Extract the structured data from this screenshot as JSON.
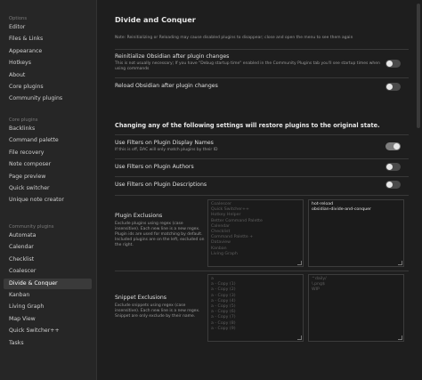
{
  "sidebar": {
    "sections": [
      {
        "label": "Options",
        "items": [
          "Editor",
          "Files & Links",
          "Appearance",
          "Hotkeys",
          "About",
          "Core plugins",
          "Community plugins"
        ]
      },
      {
        "label": "Core plugins",
        "items": [
          "Backlinks",
          "Command palette",
          "File recovery",
          "Note composer",
          "Page preview",
          "Quick switcher",
          "Unique note creator"
        ]
      },
      {
        "label": "Community plugins",
        "items": [
          "Automata",
          "Calendar",
          "Checklist",
          "Coalescer",
          "Divide & Conquer",
          "Kanban",
          "Living Graph",
          "Map View",
          "Quick Switcher++",
          "Tasks"
        ]
      }
    ],
    "active": "Divide & Conquer"
  },
  "main": {
    "title": "Divide and Conquer",
    "note": "Note: Reinitializing or Reloading may cause disabled plugins to disappear; close and open the menu to see them again",
    "settings": [
      {
        "name": "Reinitialize Obsidian after plugin changes",
        "desc": "This is not usually necessary; If you have \"Debug startup time\" enabled in the Community Plugins tab you'll see startup times when using commands",
        "on": false
      },
      {
        "name": "Reload Obsidian after plugin changes",
        "desc": "",
        "on": false
      }
    ],
    "section_heading": "Changing any of the following settings will restore plugins to the original state.",
    "filter_settings": [
      {
        "name": "Use Filters on Plugin Display Names",
        "desc": "If this is off, DAC will only match plugins by their ID",
        "on": true
      },
      {
        "name": "Use Filters on Plugin Authors",
        "desc": "",
        "on": false
      },
      {
        "name": "Use Filters on Plugin Descriptions",
        "desc": "",
        "on": false
      }
    ],
    "plugin_exclusions": {
      "name": "Plugin Exclusions",
      "desc": "Exclude plugins using regex (case insensitive). Each new line is a new regex. Plugin ids are used for matching by default. Included plugins are on the left, excluded on the right.",
      "included": [
        "Coalescer",
        "Quick Switcher++",
        "Hotkey Helper",
        "Better Command Palette",
        "Calendar",
        "Checklist",
        "Command Palette +",
        "Dataview",
        "Kanban",
        "Living Graph"
      ],
      "excluded": [
        "hot-reload",
        "obsidian-divide-and-conquer"
      ]
    },
    "snippet_exclusions": {
      "name": "Snippet Exclusions",
      "desc": "Exclude snippets using regex (case insensitive). Each new line is a new regex. Snippet are only exclude by their name.",
      "included": [
        "a",
        "a - Copy (1)",
        "a - Copy (2)",
        "a - Copy (3)",
        "a - Copy (4)",
        "a - Copy (5)",
        "a - Copy (6)",
        "a - Copy (7)",
        "a - Copy (8)",
        "a - Copy (9)"
      ],
      "excluded": [
        "^daily/",
        "\\.png$",
        "WIP"
      ]
    }
  }
}
